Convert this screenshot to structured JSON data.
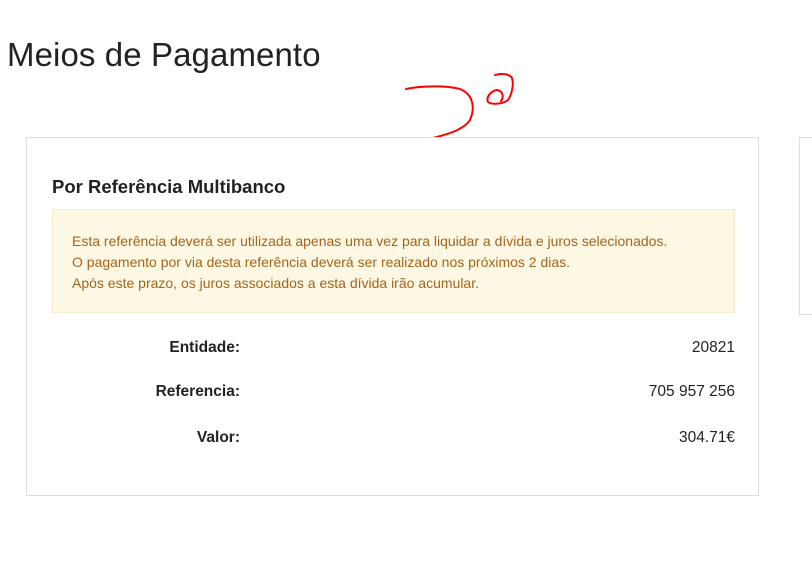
{
  "page": {
    "title": "Meios de Pagamento"
  },
  "annotation": {
    "text": "2º",
    "color": "#ff0000"
  },
  "payment_card": {
    "title": "Por Referência Multibanco",
    "notice": {
      "lines": [
        "Esta referência deverá ser utilizada apenas uma vez para liquidar a dívida e juros selecionados.",
        "O pagamento por via desta referência deverá ser realizado nos próximos 2 dias.",
        "Após este prazo, os juros associados a esta dívida irão acumular."
      ],
      "background": "#fcf8e3",
      "text_color": "#a5641b"
    },
    "details": [
      {
        "label": "Entidade:",
        "value": "20821"
      },
      {
        "label": "Referencia:",
        "value": "705 957 256"
      },
      {
        "label": "Valor:",
        "value": "304.71€"
      }
    ]
  }
}
